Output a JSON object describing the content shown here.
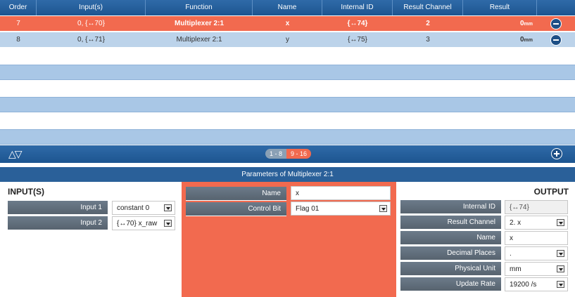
{
  "table": {
    "headers": [
      "Order",
      "Input(s)",
      "Function",
      "Name",
      "Internal ID",
      "Result Channel",
      "Result"
    ],
    "rows": [
      {
        "order": "7",
        "inputs": "0, {↔70}",
        "function": "Multiplexer 2:1",
        "name": "x",
        "internal_id": "{↔74}",
        "result_channel": "2",
        "result_value": "0",
        "result_unit": "mm",
        "selected": true
      },
      {
        "order": "8",
        "inputs": "0, {↔71}",
        "function": "Multiplexer 2:1",
        "name": "y",
        "internal_id": "{↔75}",
        "result_channel": "3",
        "result_value": "0",
        "result_unit": "mm",
        "selected": false
      }
    ]
  },
  "pager": {
    "page1": "1 - 8",
    "page2": "9 - 16",
    "arrows": "△▽"
  },
  "params": {
    "title": "Parameters of Multiplexer 2:1",
    "inputs_label": "INPUT(S)",
    "output_label": "OUTPUT",
    "inputs": [
      {
        "label": "Input 1",
        "value": "constant 0"
      },
      {
        "label": "Input 2",
        "value": "{↔70} x_raw"
      }
    ],
    "center": [
      {
        "label": "Name",
        "value": "x",
        "dropdown": false
      },
      {
        "label": "Control Bit",
        "value": "Flag 01",
        "dropdown": true
      }
    ],
    "output": [
      {
        "label": "Internal ID",
        "value": "{↔74}",
        "dropdown": false,
        "readonly": true
      },
      {
        "label": "Result Channel",
        "value": "2. x",
        "dropdown": true,
        "readonly": false
      },
      {
        "label": "Name",
        "value": "x",
        "dropdown": false,
        "readonly": false
      },
      {
        "label": "Decimal Places",
        "value": ".",
        "dropdown": true,
        "readonly": false
      },
      {
        "label": "Physical Unit",
        "value": "mm",
        "dropdown": true,
        "readonly": false
      },
      {
        "label": "Update Rate",
        "value": "19200 /s",
        "dropdown": true,
        "readonly": false
      }
    ]
  },
  "colors": {
    "header_blue": "#1d5590",
    "selected_row": "#f26a4f",
    "row_blue": "#bcd3ea",
    "label_gray": "#5f6c79"
  }
}
